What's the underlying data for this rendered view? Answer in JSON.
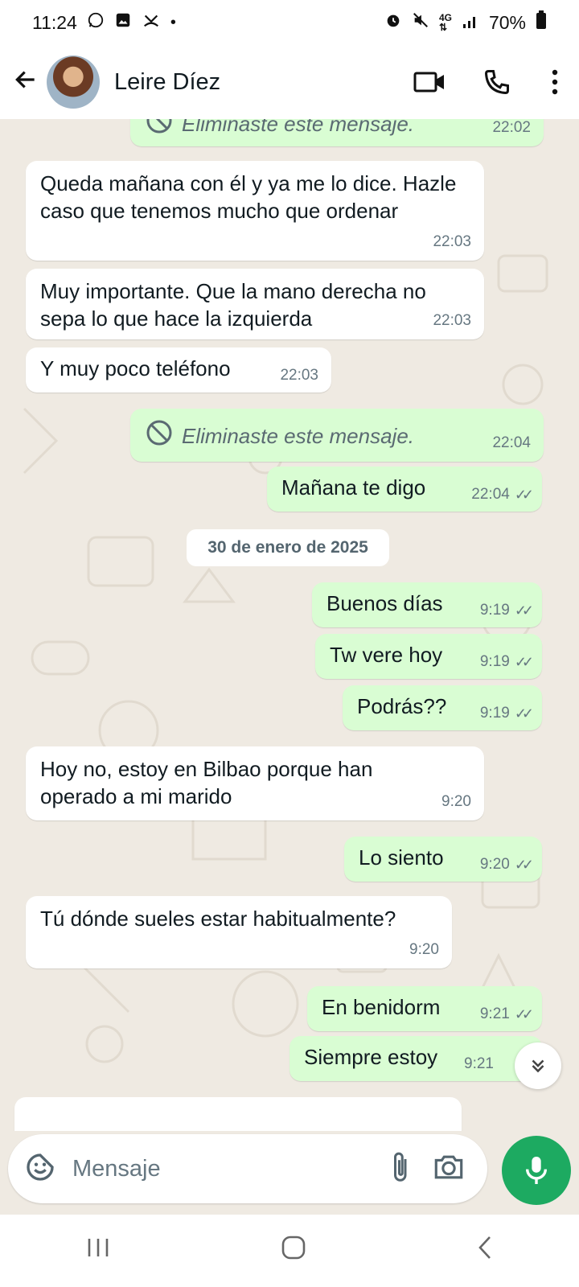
{
  "status_bar": {
    "time": "11:24",
    "battery": "70%",
    "left_icons": [
      "whatsapp-icon",
      "gallery-icon",
      "missed-call-icon",
      "dot-icon"
    ],
    "right_icons": [
      "alarm-icon",
      "mute-icon",
      "4g-icon",
      "signal-icon",
      "battery-icon"
    ]
  },
  "header": {
    "contact_name": "Leire Díez",
    "icons": [
      "back-arrow-icon",
      "avatar",
      "video-call-icon",
      "phone-icon",
      "more-options-icon"
    ]
  },
  "messages": [
    {
      "id": "m0",
      "dir": "out",
      "deleted": true,
      "text": "Eliminaste este mensaje.",
      "time": "22:02"
    },
    {
      "id": "m1",
      "dir": "in",
      "text": "Queda mañana con él y ya me lo dice. Hazle caso que tenemos mucho que ordenar",
      "time": "22:03"
    },
    {
      "id": "m2",
      "dir": "in",
      "text": "Muy importante. Que la mano derecha no sepa lo que hace la izquierda",
      "time": "22:03"
    },
    {
      "id": "m3",
      "dir": "in",
      "text": "Y muy poco teléfono",
      "time": "22:03"
    },
    {
      "id": "m4",
      "dir": "out",
      "deleted": true,
      "text": "Eliminaste este mensaje.",
      "time": "22:04"
    },
    {
      "id": "m5",
      "dir": "out",
      "text": "Mañana te digo",
      "time": "22:04",
      "read": true
    },
    {
      "id": "m6",
      "dir": "out",
      "text": "Buenos días",
      "time": "9:19",
      "read": true
    },
    {
      "id": "m7",
      "dir": "out",
      "text": "Tw vere hoy",
      "time": "9:19",
      "read": true
    },
    {
      "id": "m8",
      "dir": "out",
      "text": "Podrás??",
      "time": "9:19",
      "read": true
    },
    {
      "id": "m9",
      "dir": "in",
      "text": "Hoy no, estoy en Bilbao porque han operado a mi marido",
      "time": "9:20"
    },
    {
      "id": "m10",
      "dir": "out",
      "text": "Lo siento",
      "time": "9:20",
      "read": true
    },
    {
      "id": "m11",
      "dir": "in",
      "text": "Tú dónde sueles estar habitualmente?",
      "time": "9:20"
    },
    {
      "id": "m12",
      "dir": "out",
      "text": "En benidorm",
      "time": "9:21",
      "read": true
    },
    {
      "id": "m13",
      "dir": "out",
      "text": "Siempre estoy",
      "time": "9:21",
      "read": true
    }
  ],
  "date_separator": "30 de enero de 2025",
  "input": {
    "placeholder": "Mensaje",
    "icons": [
      "sticker-icon",
      "attach-icon",
      "camera-icon",
      "mic-icon"
    ]
  },
  "scroll_down_icon": "double-chevron-down-icon",
  "nav_bar": {
    "icons": [
      "recents-icon",
      "home-icon",
      "back-icon"
    ]
  },
  "colors": {
    "chat_bg": "#efeae2",
    "outgoing_bubble": "#d9fdd3",
    "incoming_bubble": "#ffffff",
    "accent_green": "#1daa61",
    "meta_text": "#667781"
  }
}
